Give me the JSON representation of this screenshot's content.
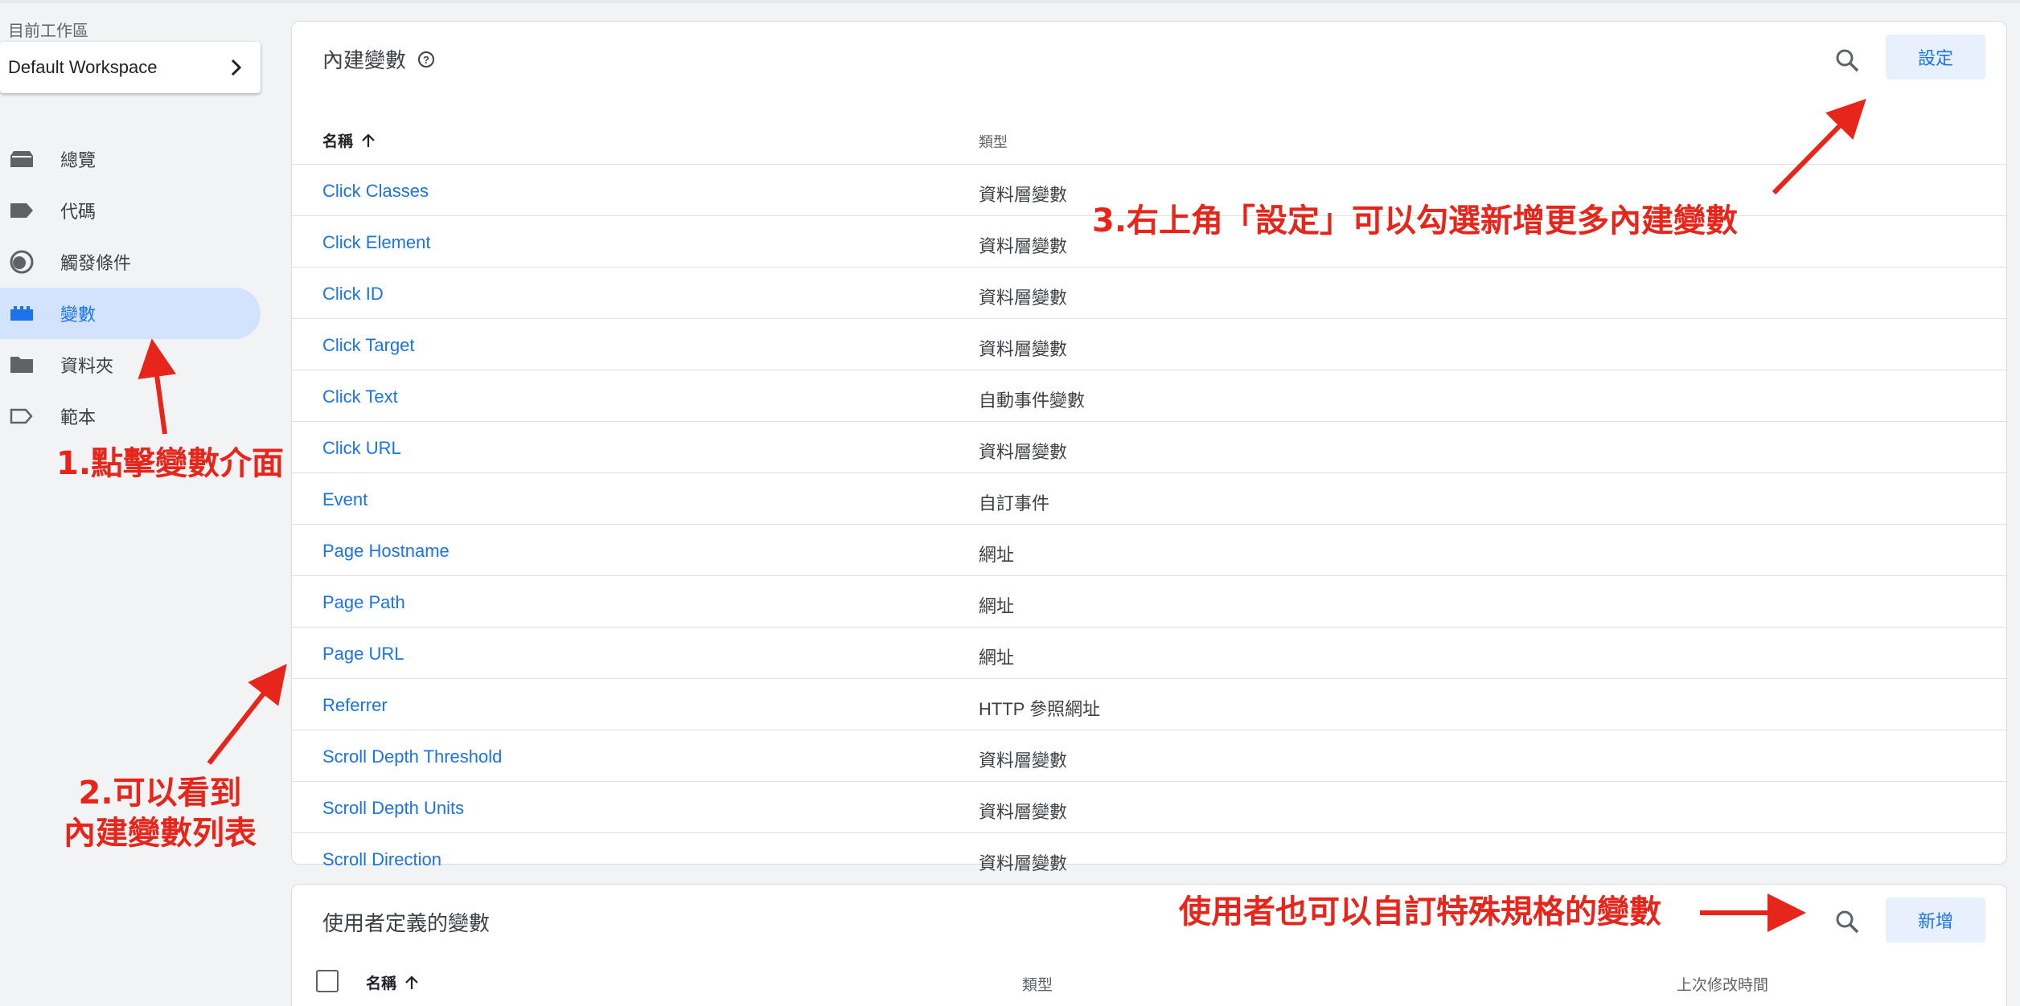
{
  "sidebar": {
    "workspace_label": "目前工作區",
    "workspace_name": "Default Workspace",
    "items": [
      {
        "label": "總覽",
        "icon": "overview-icon"
      },
      {
        "label": "代碼",
        "icon": "tag-icon"
      },
      {
        "label": "觸發條件",
        "icon": "trigger-icon"
      },
      {
        "label": "變數",
        "icon": "variable-icon",
        "active": true
      },
      {
        "label": "資料夾",
        "icon": "folder-icon"
      },
      {
        "label": "範本",
        "icon": "template-icon"
      }
    ]
  },
  "builtin": {
    "title": "內建變數",
    "configure_label": "設定",
    "col_name": "名稱",
    "col_type": "類型",
    "rows": [
      {
        "name": "Click Classes",
        "type": "資料層變數"
      },
      {
        "name": "Click Element",
        "type": "資料層變數"
      },
      {
        "name": "Click ID",
        "type": "資料層變數"
      },
      {
        "name": "Click Target",
        "type": "資料層變數"
      },
      {
        "name": "Click Text",
        "type": "自動事件變數"
      },
      {
        "name": "Click URL",
        "type": "資料層變數"
      },
      {
        "name": "Event",
        "type": "自訂事件"
      },
      {
        "name": "Page Hostname",
        "type": "網址"
      },
      {
        "name": "Page Path",
        "type": "網址"
      },
      {
        "name": "Page URL",
        "type": "網址"
      },
      {
        "name": "Referrer",
        "type": "HTTP 參照網址"
      },
      {
        "name": "Scroll Depth Threshold",
        "type": "資料層變數"
      },
      {
        "name": "Scroll Depth Units",
        "type": "資料層變數"
      },
      {
        "name": "Scroll Direction",
        "type": "資料層變數"
      }
    ]
  },
  "user_defined": {
    "title": "使用者定義的變數",
    "new_label": "新增",
    "col_name": "名稱",
    "col_type": "類型",
    "col_modified": "上次修改時間"
  },
  "annotations": {
    "step1": "1.點擊變數介面",
    "step2_line1": "2.可以看到",
    "step2_line2": "內建變數列表",
    "step3": "3.右上角「設定」可以勾選新增更多內建變數",
    "step4": "使用者也可以自訂特殊規格的變數"
  },
  "colors": {
    "accent": "#1a73e8",
    "annotation": "#e8251a",
    "active_bg": "#d3e3fd"
  }
}
